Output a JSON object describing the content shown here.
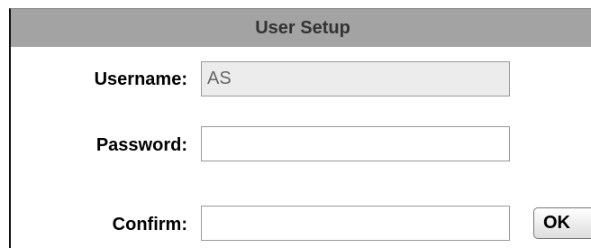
{
  "dialog": {
    "title": "User Setup"
  },
  "form": {
    "username": {
      "label": "Username:",
      "value": "AS"
    },
    "password": {
      "label": "Password:",
      "value": ""
    },
    "confirm": {
      "label": "Confirm:",
      "value": ""
    }
  },
  "actions": {
    "ok_label": "OK"
  }
}
